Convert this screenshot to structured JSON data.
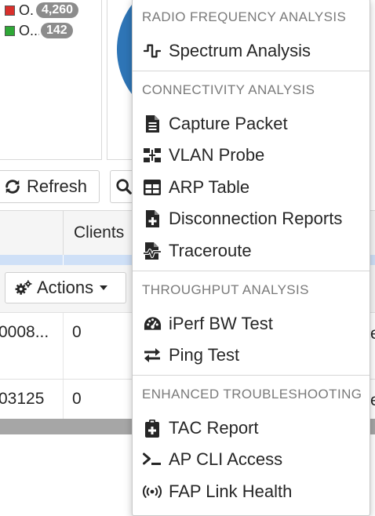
{
  "legend": {
    "items": [
      {
        "label": "O.",
        "count": "4,260",
        "color": "#d9302c"
      },
      {
        "label": "O...",
        "count": "142",
        "color": "#2ea836"
      }
    ]
  },
  "chart": {
    "color": "#2e75b6"
  },
  "toolbar": {
    "refresh_label": "Refresh",
    "refresh_icon": "refresh-icon",
    "search_icon": "search-icon"
  },
  "table": {
    "clients_header": "Clients",
    "actions_label": "Actions",
    "actions_icon": "gears-icon",
    "rows": [
      {
        "col1": "0008...",
        "clients": "0",
        "trail": "e"
      },
      {
        "col1": "03125",
        "clients": "0",
        "trail": "e"
      }
    ],
    "highlight_color": "#cfe0f7"
  },
  "menu": {
    "sections": [
      {
        "header": "RADIO FREQUENCY ANALYSIS",
        "items": [
          {
            "label": "Spectrum Analysis",
            "icon": "waveform-icon"
          }
        ]
      },
      {
        "header": "CONNECTIVITY ANALYSIS",
        "items": [
          {
            "label": "Capture Packet",
            "icon": "file-text-icon"
          },
          {
            "label": "VLAN Probe",
            "icon": "network-wired-icon"
          },
          {
            "label": "ARP Table",
            "icon": "table-icon"
          },
          {
            "label": "Disconnection Reports",
            "icon": "file-medical-icon"
          },
          {
            "label": "Traceroute",
            "icon": "file-waveform-icon"
          }
        ]
      },
      {
        "header": "THROUGHPUT ANALYSIS",
        "items": [
          {
            "label": "iPerf BW Test",
            "icon": "gauge-icon"
          },
          {
            "label": "Ping Test",
            "icon": "exchange-arrows-icon"
          }
        ]
      },
      {
        "header": "ENHANCED TROUBLESHOOTING",
        "items": [
          {
            "label": "TAC Report",
            "icon": "clipboard-medical-icon"
          },
          {
            "label": "AP CLI Access",
            "icon": "terminal-icon"
          },
          {
            "label": "FAP Link Health",
            "icon": "broadcast-icon"
          }
        ]
      }
    ]
  }
}
